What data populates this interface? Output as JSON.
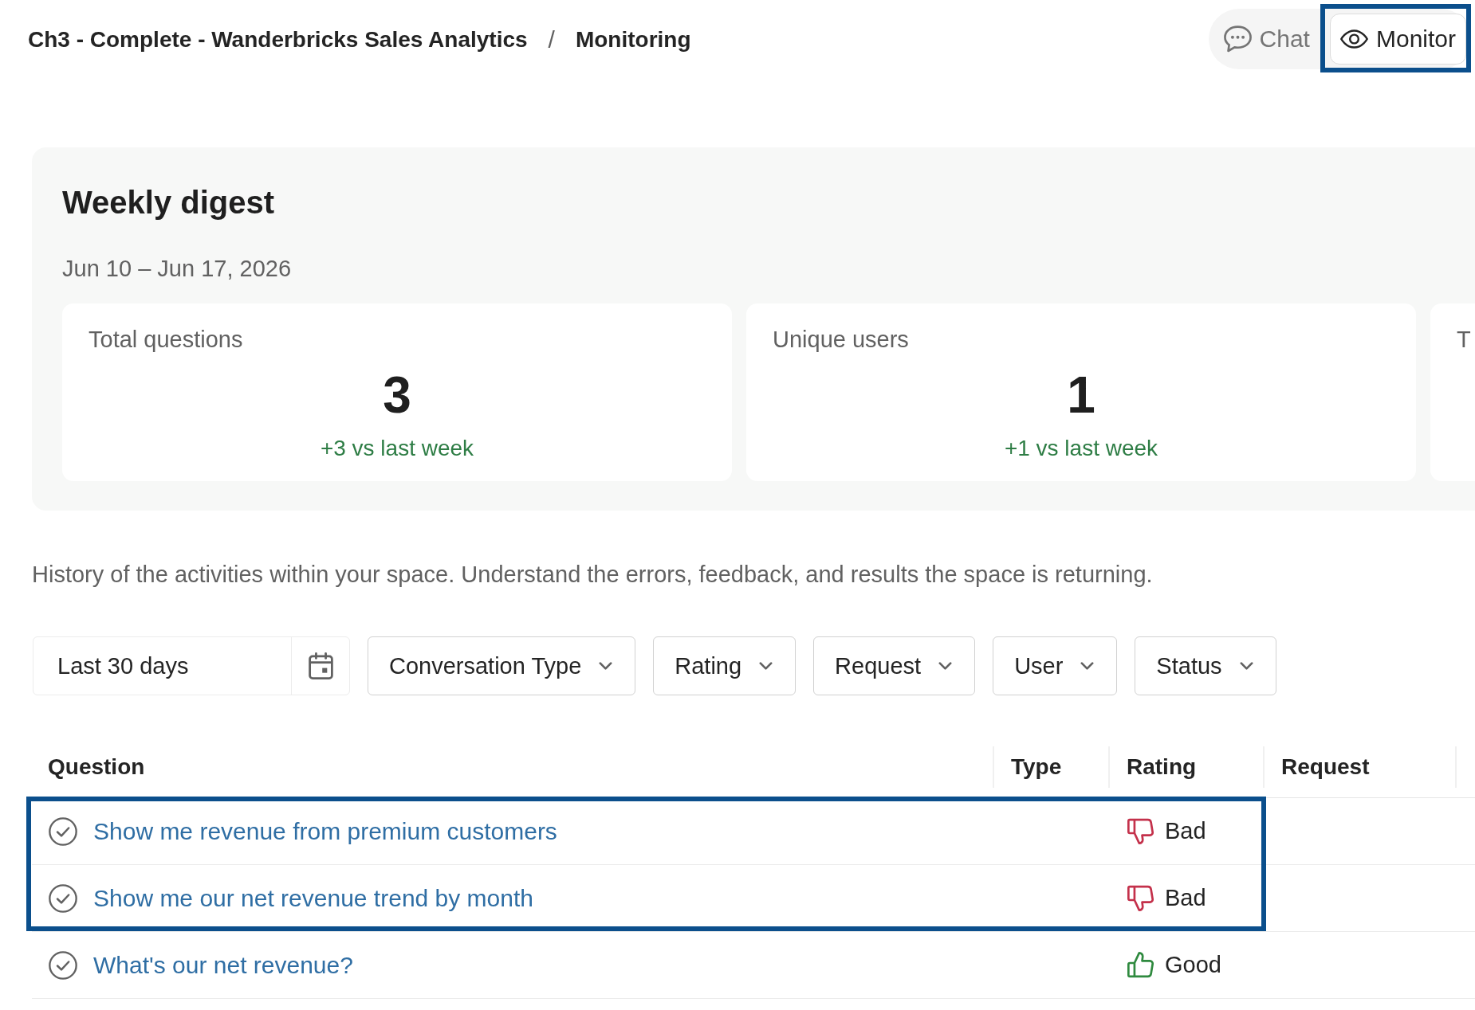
{
  "breadcrumb": {
    "items": [
      "Ch3 - Complete - Wanderbricks Sales Analytics",
      "Monitoring"
    ],
    "separator": "/"
  },
  "view_toggle": [
    {
      "kind": "chat",
      "label": "Chat",
      "selected": false,
      "highlighted": false
    },
    {
      "kind": "monitor",
      "label": "Monitor",
      "selected": true,
      "highlighted": true
    }
  ],
  "digest": {
    "title": "Weekly digest",
    "date_range": "Jun 10 – Jun 17, 2026",
    "cards": [
      {
        "label": "Total questions",
        "value": "3",
        "delta": "+3 vs last week"
      },
      {
        "label": "Unique users",
        "value": "1",
        "delta": "+1 vs last week"
      },
      {
        "label": "T"
      }
    ]
  },
  "description": "History of the activities within your space. Understand the errors, feedback, and results the space is returning.",
  "filters": [
    {
      "kind": "date",
      "value": "Last 30 days"
    },
    {
      "kind": "dropdown",
      "label": "Conversation Type"
    },
    {
      "kind": "dropdown",
      "label": "Rating"
    },
    {
      "kind": "dropdown",
      "label": "Request"
    },
    {
      "kind": "dropdown",
      "label": "User"
    },
    {
      "kind": "dropdown",
      "label": "Status"
    }
  ],
  "table": {
    "columns": [
      {
        "label": "Question"
      },
      {
        "label": "Type"
      },
      {
        "label": "Rating"
      },
      {
        "label": "Request"
      }
    ],
    "rows": [
      {
        "question": "Show me revenue from premium customers",
        "rating": {
          "kind": "bad",
          "label": "Bad"
        },
        "highlighted": true
      },
      {
        "question": "Show me our net revenue trend by month",
        "rating": {
          "kind": "bad",
          "label": "Bad"
        },
        "highlighted": true
      },
      {
        "question": "What's our net revenue?",
        "rating": {
          "kind": "good",
          "label": "Good"
        },
        "highlighted": false
      }
    ]
  }
}
